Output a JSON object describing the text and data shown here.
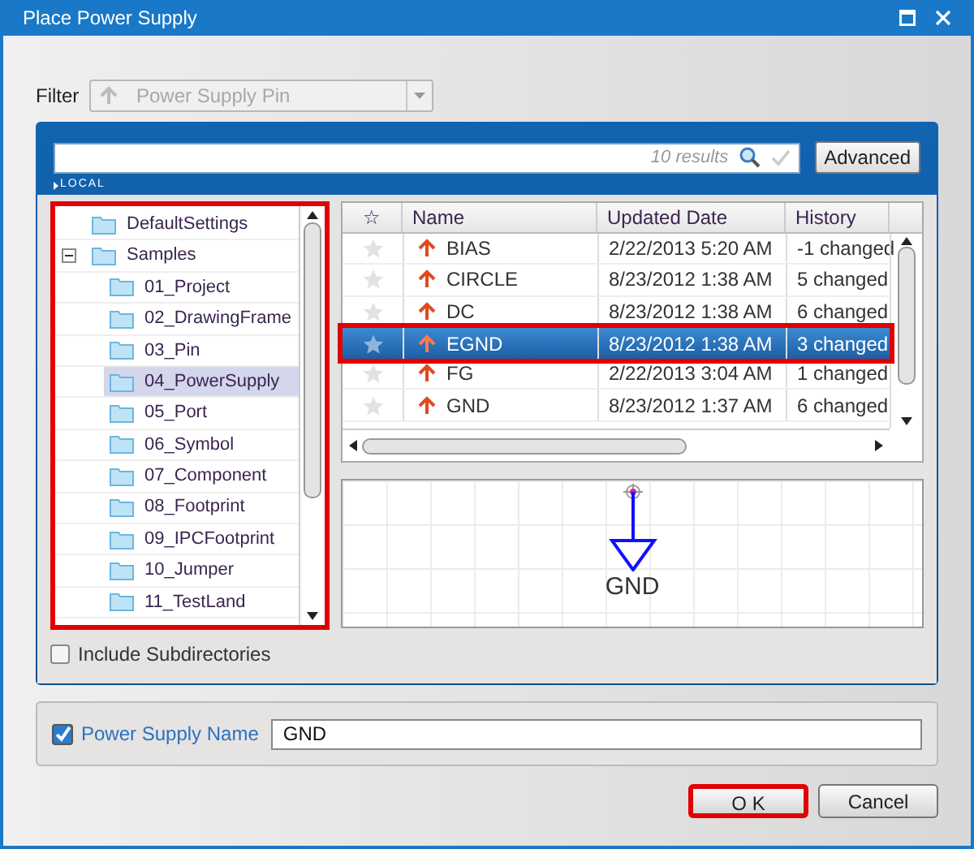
{
  "window": {
    "title": "Place Power Supply"
  },
  "filter": {
    "label": "Filter",
    "value": "Power Supply Pin",
    "disabled": true
  },
  "search": {
    "result_count": "10 results",
    "scope": "LOCAL",
    "advanced_button": "Advanced"
  },
  "tree": {
    "highlighted": true,
    "items": [
      {
        "label": "DefaultSettings",
        "selected": false
      },
      {
        "label": "Samples",
        "selected": false,
        "expanded": true,
        "children": [
          {
            "label": "01_Project",
            "selected": false
          },
          {
            "label": "02_DrawingFrame",
            "selected": false
          },
          {
            "label": "03_Pin",
            "selected": false
          },
          {
            "label": "04_PowerSupply",
            "selected": true
          },
          {
            "label": "05_Port",
            "selected": false
          },
          {
            "label": "06_Symbol",
            "selected": false
          },
          {
            "label": "07_Component",
            "selected": false
          },
          {
            "label": "08_Footprint",
            "selected": false
          },
          {
            "label": "09_IPCFootprint",
            "selected": false
          },
          {
            "label": "10_Jumper",
            "selected": false
          },
          {
            "label": "11_TestLand",
            "selected": false
          }
        ]
      }
    ]
  },
  "include_subdirectories": {
    "label": "Include Subdirectories",
    "checked": false
  },
  "table": {
    "columns": [
      "☆",
      "Name",
      "Updated Date",
      "History"
    ],
    "rows": [
      {
        "name": "BIAS",
        "updated": "2/22/2013 5:20 AM",
        "history": "-1 changed",
        "selected": false,
        "highlighted": false
      },
      {
        "name": "CIRCLE",
        "updated": "8/23/2012 1:38 AM",
        "history": "5 changed",
        "selected": false,
        "highlighted": false
      },
      {
        "name": "DC",
        "updated": "8/23/2012 1:38 AM",
        "history": "6 changed",
        "selected": false,
        "highlighted": false
      },
      {
        "name": "EGND",
        "updated": "8/23/2012 1:38 AM",
        "history": "3 changed",
        "selected": true,
        "highlighted": true
      },
      {
        "name": "FG",
        "updated": "2/22/2013 3:04 AM",
        "history": "1 changed",
        "selected": false,
        "highlighted": false
      },
      {
        "name": "GND",
        "updated": "8/23/2012 1:37 AM",
        "history": "6 changed",
        "selected": false,
        "highlighted": false
      }
    ]
  },
  "preview": {
    "symbol_label": "GND"
  },
  "power_supply_name": {
    "label": "Power Supply Name",
    "checked": true,
    "value": "GND"
  },
  "buttons": [
    {
      "label": "O K",
      "highlighted": true
    },
    {
      "label": "Cancel",
      "highlighted": false
    }
  ]
}
